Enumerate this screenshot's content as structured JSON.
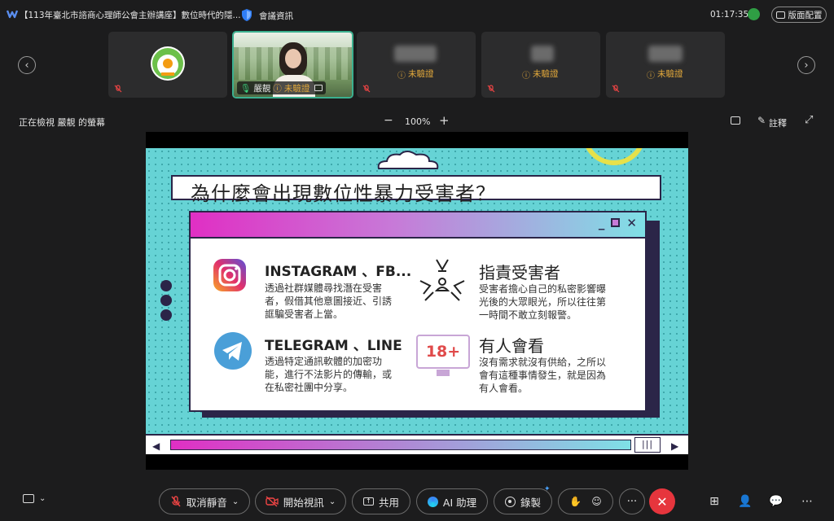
{
  "topbar": {
    "title": "【113年臺北市諮商心理師公會主辦講座】數位時代的隱...",
    "meeting_info": "會議資訊",
    "clock": "01:17:35",
    "layout_button": "版面配置"
  },
  "participants": [
    {
      "label": "",
      "status": ""
    },
    {
      "label": "嚴靚",
      "status": "未驗證"
    },
    {
      "label": "",
      "status": "未驗證"
    },
    {
      "label": "",
      "status": "未驗證"
    },
    {
      "label": "",
      "status": "未驗證"
    }
  ],
  "viewbar": {
    "viewing": "正在檢視 嚴靚 的螢幕",
    "zoom_minus": "−",
    "zoom_level": "100%",
    "zoom_plus": "+",
    "annotate": "註釋"
  },
  "slide": {
    "title": "為什麼會出現數位性暴力受害者？",
    "features": [
      {
        "title": "INSTAGRAM 、FB...",
        "text": "透過社群媒體尋找潛在受害者，假借其他意圖接近、引誘誆騙受害者上當。"
      },
      {
        "title": "指責受害者",
        "text": "受害者擔心自己的私密影響曝光後的大眾眼光，所以往往第一時間不敢立刻報警。"
      },
      {
        "title": "TELEGRAM 、LINE",
        "text": "透過特定通訊軟體的加密功能，進行不法影片的傳輸，或在私密社團中分享。"
      },
      {
        "title": "有人會看",
        "text": "沒有需求就沒有供給，之所以會有這種事情發生，就是因為有人會看。"
      }
    ],
    "badge": "18+"
  },
  "toolbar": {
    "unmute": "取消靜音",
    "start_video": "開始視訊",
    "share": "共用",
    "ai": "AI 助理",
    "record": "錄製",
    "more": "···"
  },
  "colors": {
    "accent": "#3bb08f",
    "leave": "#e6353d",
    "slide_bg": "#66d3d5",
    "navy": "#2b2548"
  }
}
